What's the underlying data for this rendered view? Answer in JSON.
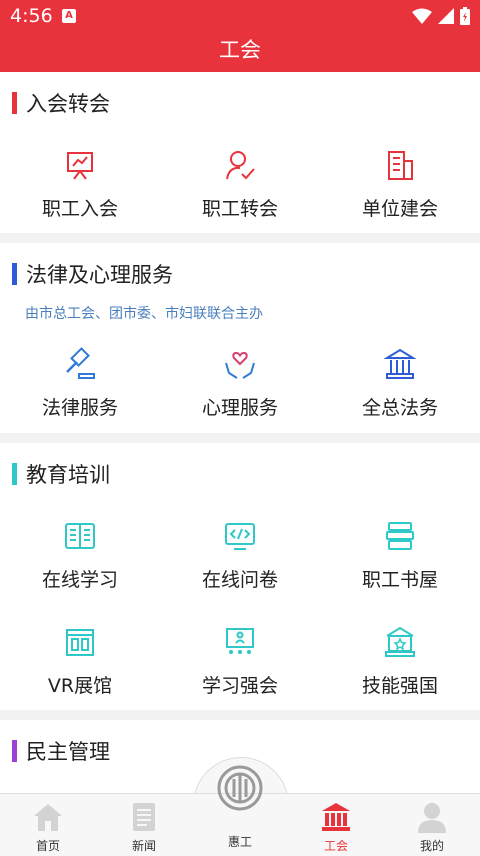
{
  "status": {
    "time": "4:56",
    "notif_icon": "a-icon"
  },
  "header": {
    "title": "工会"
  },
  "sections": [
    {
      "title": "入会转会",
      "color": "#e8323c",
      "items": [
        {
          "label": "职工入会",
          "icon": "presentation-icon"
        },
        {
          "label": "职工转会",
          "icon": "user-check-icon"
        },
        {
          "label": "单位建会",
          "icon": "building-icon"
        }
      ]
    },
    {
      "title": "法律及心理服务",
      "color": "#2f5bd7",
      "subtitle": "由市总工会、团市委、市妇联联合主办",
      "items": [
        {
          "label": "法律服务",
          "icon": "gavel-icon"
        },
        {
          "label": "心理服务",
          "icon": "heart-hands-icon"
        },
        {
          "label": "全总法务",
          "icon": "courthouse-icon"
        }
      ]
    },
    {
      "title": "教育培训",
      "color": "#2ec8c8",
      "items": [
        {
          "label": "在线学习",
          "icon": "book-icon"
        },
        {
          "label": "在线问卷",
          "icon": "code-screen-icon"
        },
        {
          "label": "职工书屋",
          "icon": "bookshelf-icon"
        },
        {
          "label": "VR展馆",
          "icon": "gallery-icon"
        },
        {
          "label": "学习强会",
          "icon": "classroom-icon"
        },
        {
          "label": "技能强国",
          "icon": "skill-star-icon"
        }
      ]
    },
    {
      "title": "民主管理",
      "color": "#9b3fd6"
    }
  ],
  "bottom_nav": [
    {
      "label": "首页",
      "icon": "home-icon"
    },
    {
      "label": "新闻",
      "icon": "news-icon"
    },
    {
      "label": "惠工",
      "icon": "union-logo-icon"
    },
    {
      "label": "工会",
      "icon": "union-building-icon",
      "active": true,
      "active_color": "#e8323c"
    },
    {
      "label": "我的",
      "icon": "profile-icon"
    }
  ]
}
